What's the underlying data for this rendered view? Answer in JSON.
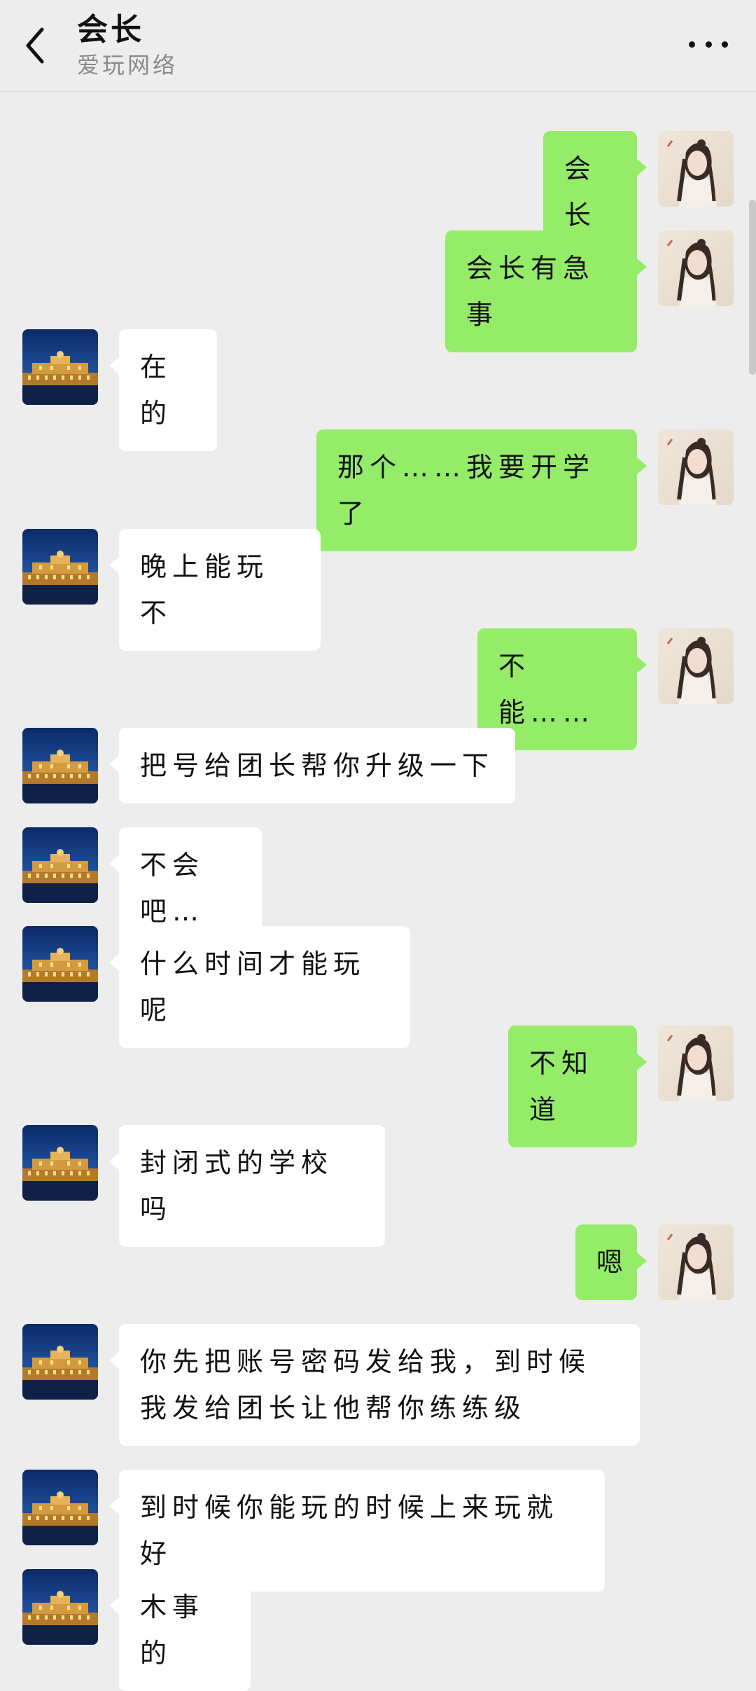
{
  "header": {
    "title": "会长",
    "subtitle": "爱玩网络"
  },
  "avatars": {
    "self": "anime-girl-avatar",
    "contact": "palace-at-night-avatar"
  },
  "messages": [
    {
      "side": "out",
      "text": "会长"
    },
    {
      "side": "out",
      "text": "会长有急事"
    },
    {
      "side": "in",
      "text": "在的"
    },
    {
      "side": "out",
      "text": "那个……我要开学了"
    },
    {
      "side": "in",
      "text": "晚上能玩不"
    },
    {
      "side": "out",
      "text": "不能……"
    },
    {
      "side": "in",
      "text": "把号给团长帮你升级一下"
    },
    {
      "side": "in",
      "text": "不会吧…"
    },
    {
      "side": "in",
      "text": "什么时间才能玩呢"
    },
    {
      "side": "out",
      "text": "不知道"
    },
    {
      "side": "in",
      "text": "封闭式的学校吗"
    },
    {
      "side": "out",
      "text": "嗯"
    },
    {
      "side": "in",
      "text": "你先把账号密码发给我，到时候我发给团长让他帮你练练级"
    },
    {
      "side": "in",
      "text": "到时候你能玩的时候上来玩就好"
    },
    {
      "side": "in",
      "text": "木事的"
    }
  ]
}
